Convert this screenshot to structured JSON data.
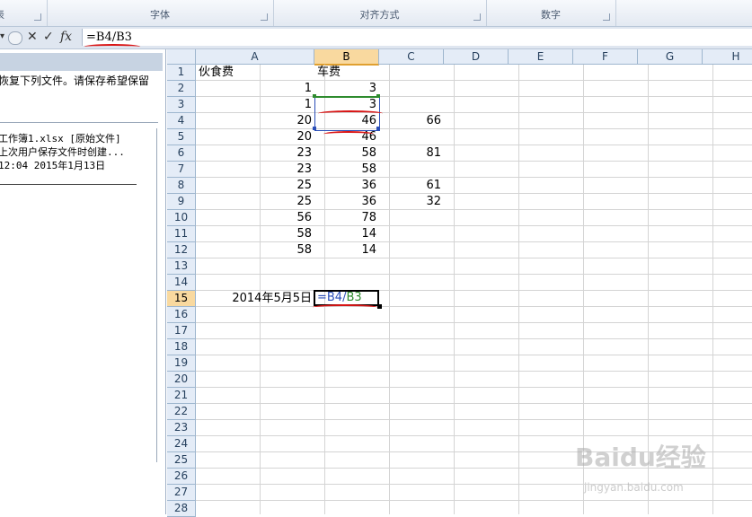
{
  "ribbon": {
    "groups": [
      {
        "label": "表"
      },
      {
        "label": "字体"
      },
      {
        "label": "对齐方式"
      },
      {
        "label": "数字"
      }
    ]
  },
  "formula_bar": {
    "name_box_arrow": "▾",
    "cancel_icon": "✕",
    "enter_icon": "✓",
    "fx_label": "fx",
    "formula": "=B4/B3"
  },
  "recovery_pane": {
    "message": "恢复下列文件。请保存希望保留",
    "file": {
      "name_line": "工作簿1.xlsx  [原始文件]",
      "desc_line": "上次用户保存文件时创建...",
      "time_line": "12:04 2015年1月13日"
    }
  },
  "sheet": {
    "columns": [
      "A",
      "B",
      "C",
      "D",
      "E",
      "F",
      "G",
      "H"
    ],
    "rows": [
      "1",
      "2",
      "3",
      "4",
      "5",
      "6",
      "7",
      "8",
      "9",
      "10",
      "11",
      "12",
      "13",
      "14",
      "15",
      "16",
      "17",
      "18",
      "19",
      "20",
      "21",
      "22",
      "23",
      "24",
      "25",
      "26",
      "27",
      "28"
    ],
    "selected_column": "B",
    "selected_row": "15",
    "cells": {
      "A1": "伙食费",
      "B1": "车费",
      "A2": "1",
      "B2": "3",
      "A3": "1",
      "B3": "3",
      "A4": "20",
      "B4": "46",
      "C4": "66",
      "A5": "20",
      "B5": "46",
      "A6": "23",
      "B6": "58",
      "C6": "81",
      "A7": "23",
      "B7": "58",
      "A8": "25",
      "B8": "36",
      "C8": "61",
      "A9": "25",
      "B9": "36",
      "C9": "32",
      "A10": "56",
      "B10": "78",
      "A11": "58",
      "B11": "14",
      "A12": "58",
      "B12": "14",
      "A15": "2014年5月5日",
      "B15_part1": "=B4/",
      "B15_part2": "B3"
    }
  },
  "watermark": {
    "brand": "Baidu经验",
    "url": "jingyan.baidu.com"
  },
  "colors": {
    "ref_blue": "#2b4fb8",
    "ref_green": "#2e8b2e",
    "annotation_red": "#d91414",
    "selected_header": "#f9d99f"
  }
}
